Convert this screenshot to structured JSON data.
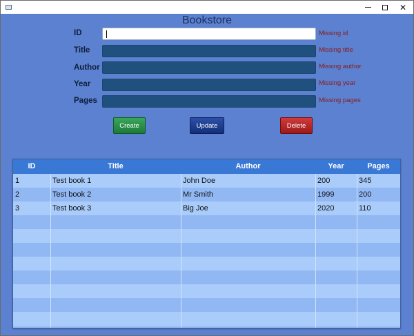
{
  "window": {
    "title": ""
  },
  "form": {
    "title": "Bookstore",
    "fields": [
      {
        "label": "ID",
        "value": "",
        "error": "Missing id"
      },
      {
        "label": "Title",
        "value": "",
        "error": "Missing title"
      },
      {
        "label": "Author",
        "value": "",
        "error": "Missing author"
      },
      {
        "label": "Year",
        "value": "",
        "error": "Missing year"
      },
      {
        "label": "Pages",
        "value": "",
        "error": "Missing pages"
      }
    ]
  },
  "buttons": {
    "create": "Create",
    "update": "Update",
    "delete": "Delete"
  },
  "colors": {
    "background": "#5b81d0",
    "header": "#3a78d6",
    "field": "#20507d",
    "error": "#8b1a1a",
    "create": "#1e7a3a",
    "update": "#142f7a",
    "delete": "#9c1a1a"
  },
  "table": {
    "columns": [
      "ID",
      "Title",
      "Author",
      "Year",
      "Pages"
    ],
    "rows": [
      [
        "1",
        "Test book 1",
        "John Doe",
        "200",
        "345"
      ],
      [
        "2",
        "Test book 2",
        "Mr Smith",
        "1999",
        "200"
      ],
      [
        "3",
        "Test book 3",
        "Big Joe",
        "2020",
        "110"
      ]
    ]
  }
}
